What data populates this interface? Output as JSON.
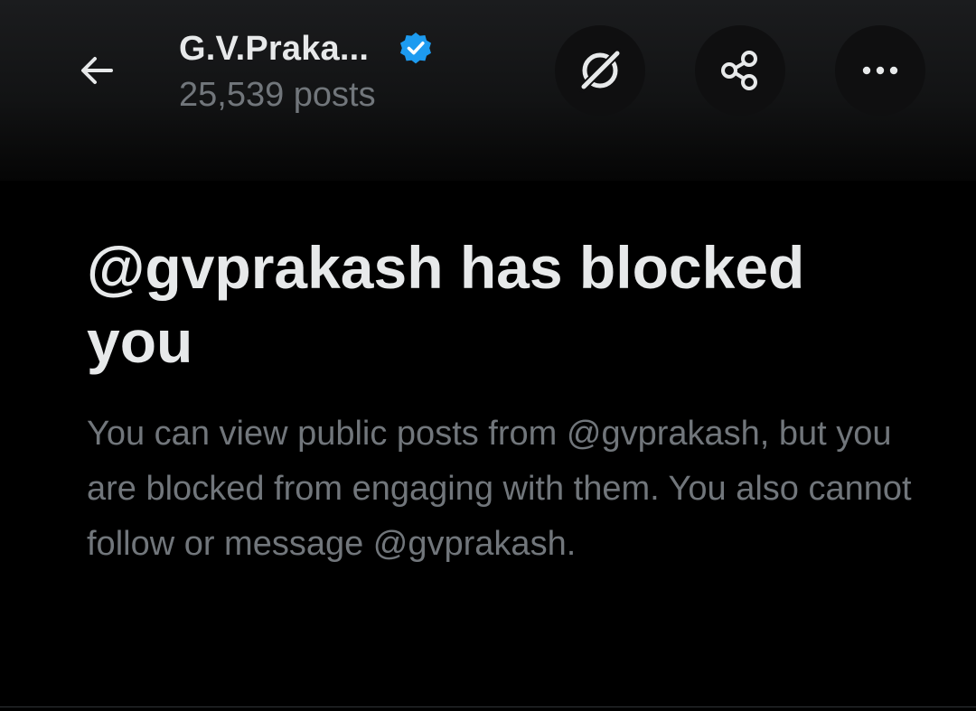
{
  "header": {
    "profile_name": "G.V.Praka...",
    "post_count": "25,539 posts",
    "icons": {
      "back": "arrow-left-icon",
      "verified": "verified-badge-icon",
      "grok": "grok-icon",
      "share": "share-icon",
      "more": "more-horizontal-icon"
    }
  },
  "blocked": {
    "title": "@gvprakash has blocked you",
    "description": "You can view public posts from @gvprakash, but you are blocked from engaging with them. You also cannot follow or message @gvprakash."
  },
  "colors": {
    "background": "#000000",
    "primary_text": "#e7e9ea",
    "secondary_text": "#71767b",
    "verified_blue": "#1d9bf0"
  }
}
